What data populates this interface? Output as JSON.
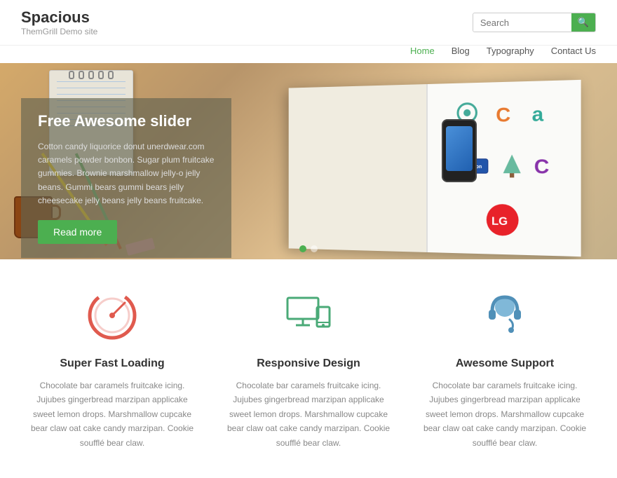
{
  "site": {
    "title": "Spacious",
    "subtitle": "ThemGrill Demo site"
  },
  "search": {
    "placeholder": "Search",
    "button_icon": "🔍"
  },
  "nav": {
    "items": [
      {
        "label": "Home",
        "active": true
      },
      {
        "label": "Blog",
        "active": false
      },
      {
        "label": "Typography",
        "active": false
      },
      {
        "label": "Contact Us",
        "active": false
      }
    ]
  },
  "hero": {
    "title": "Free Awesome slider",
    "text": "Cotton candy liquorice donut unerdwear.com caramels powder bonbon. Sugar plum fruitcake gummies. Brownie marshmallow jelly-o jelly beans. Gummi bears gummi bears jelly cheesecake jelly beans jelly beans fruitcake.",
    "button_label": "Read more",
    "dots": [
      {
        "active": true
      },
      {
        "active": false
      }
    ]
  },
  "features": [
    {
      "id": "speed",
      "title": "Super Fast Loading",
      "text": "Chocolate bar caramels fruitcake icing. Jujubes gingerbread marzipan applicake sweet lemon drops. Marshmallow cupcake bear claw oat cake candy marzipan. Cookie soufflé bear claw.",
      "icon": "speed"
    },
    {
      "id": "responsive",
      "title": "Responsive Design",
      "text": "Chocolate bar caramels fruitcake icing. Jujubes gingerbread marzipan applicake sweet lemon drops. Marshmallow cupcake bear claw oat cake candy marzipan. Cookie soufflé bear claw.",
      "icon": "responsive"
    },
    {
      "id": "support",
      "title": "Awesome Support",
      "text": "Chocolate bar caramels fruitcake icing. Jujubes gingerbread marzipan applicake sweet lemon drops. Marshmallow cupcake bear claw oat cake candy marzipan. Cookie soufflé bear claw.",
      "icon": "support"
    }
  ]
}
